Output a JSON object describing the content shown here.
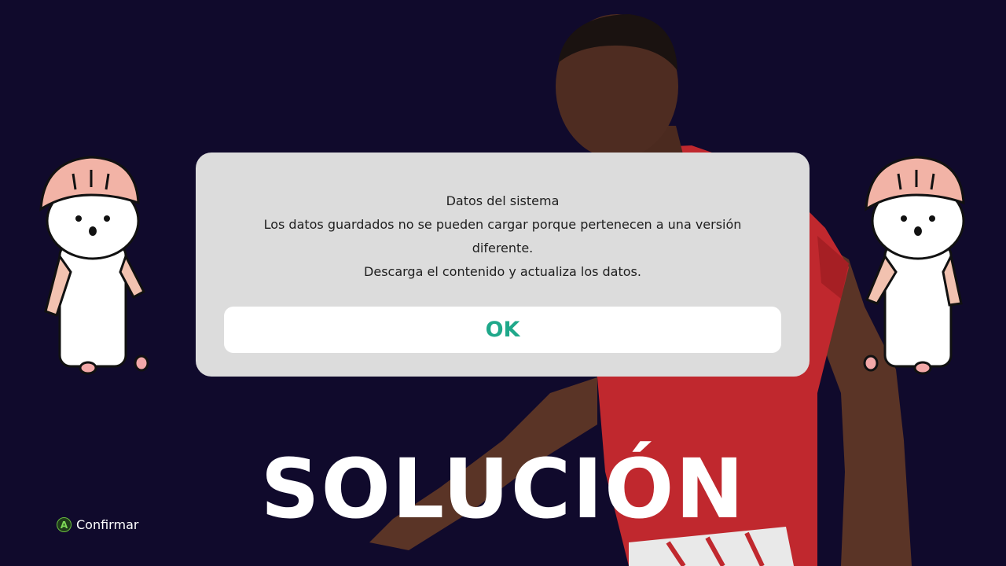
{
  "dialog": {
    "title": "Datos del sistema",
    "message_line1": "Los datos guardados no se pueden cargar porque pertenecen a una versión",
    "message_line2": "diferente.",
    "message_line3": "Descarga el contenido y actualiza los datos.",
    "ok_label": "OK"
  },
  "overlay": {
    "headline": "SOLUCIÓN"
  },
  "footer": {
    "button_glyph": "A",
    "confirm_label": "Confirmar"
  },
  "colors": {
    "background": "#100a2c",
    "dialog": "#dcdcdc",
    "ok_text": "#1fa88a",
    "jersey": "#c0282e",
    "mascot_hat": "#f2b3a6",
    "controller_a": "#6abf3f"
  }
}
